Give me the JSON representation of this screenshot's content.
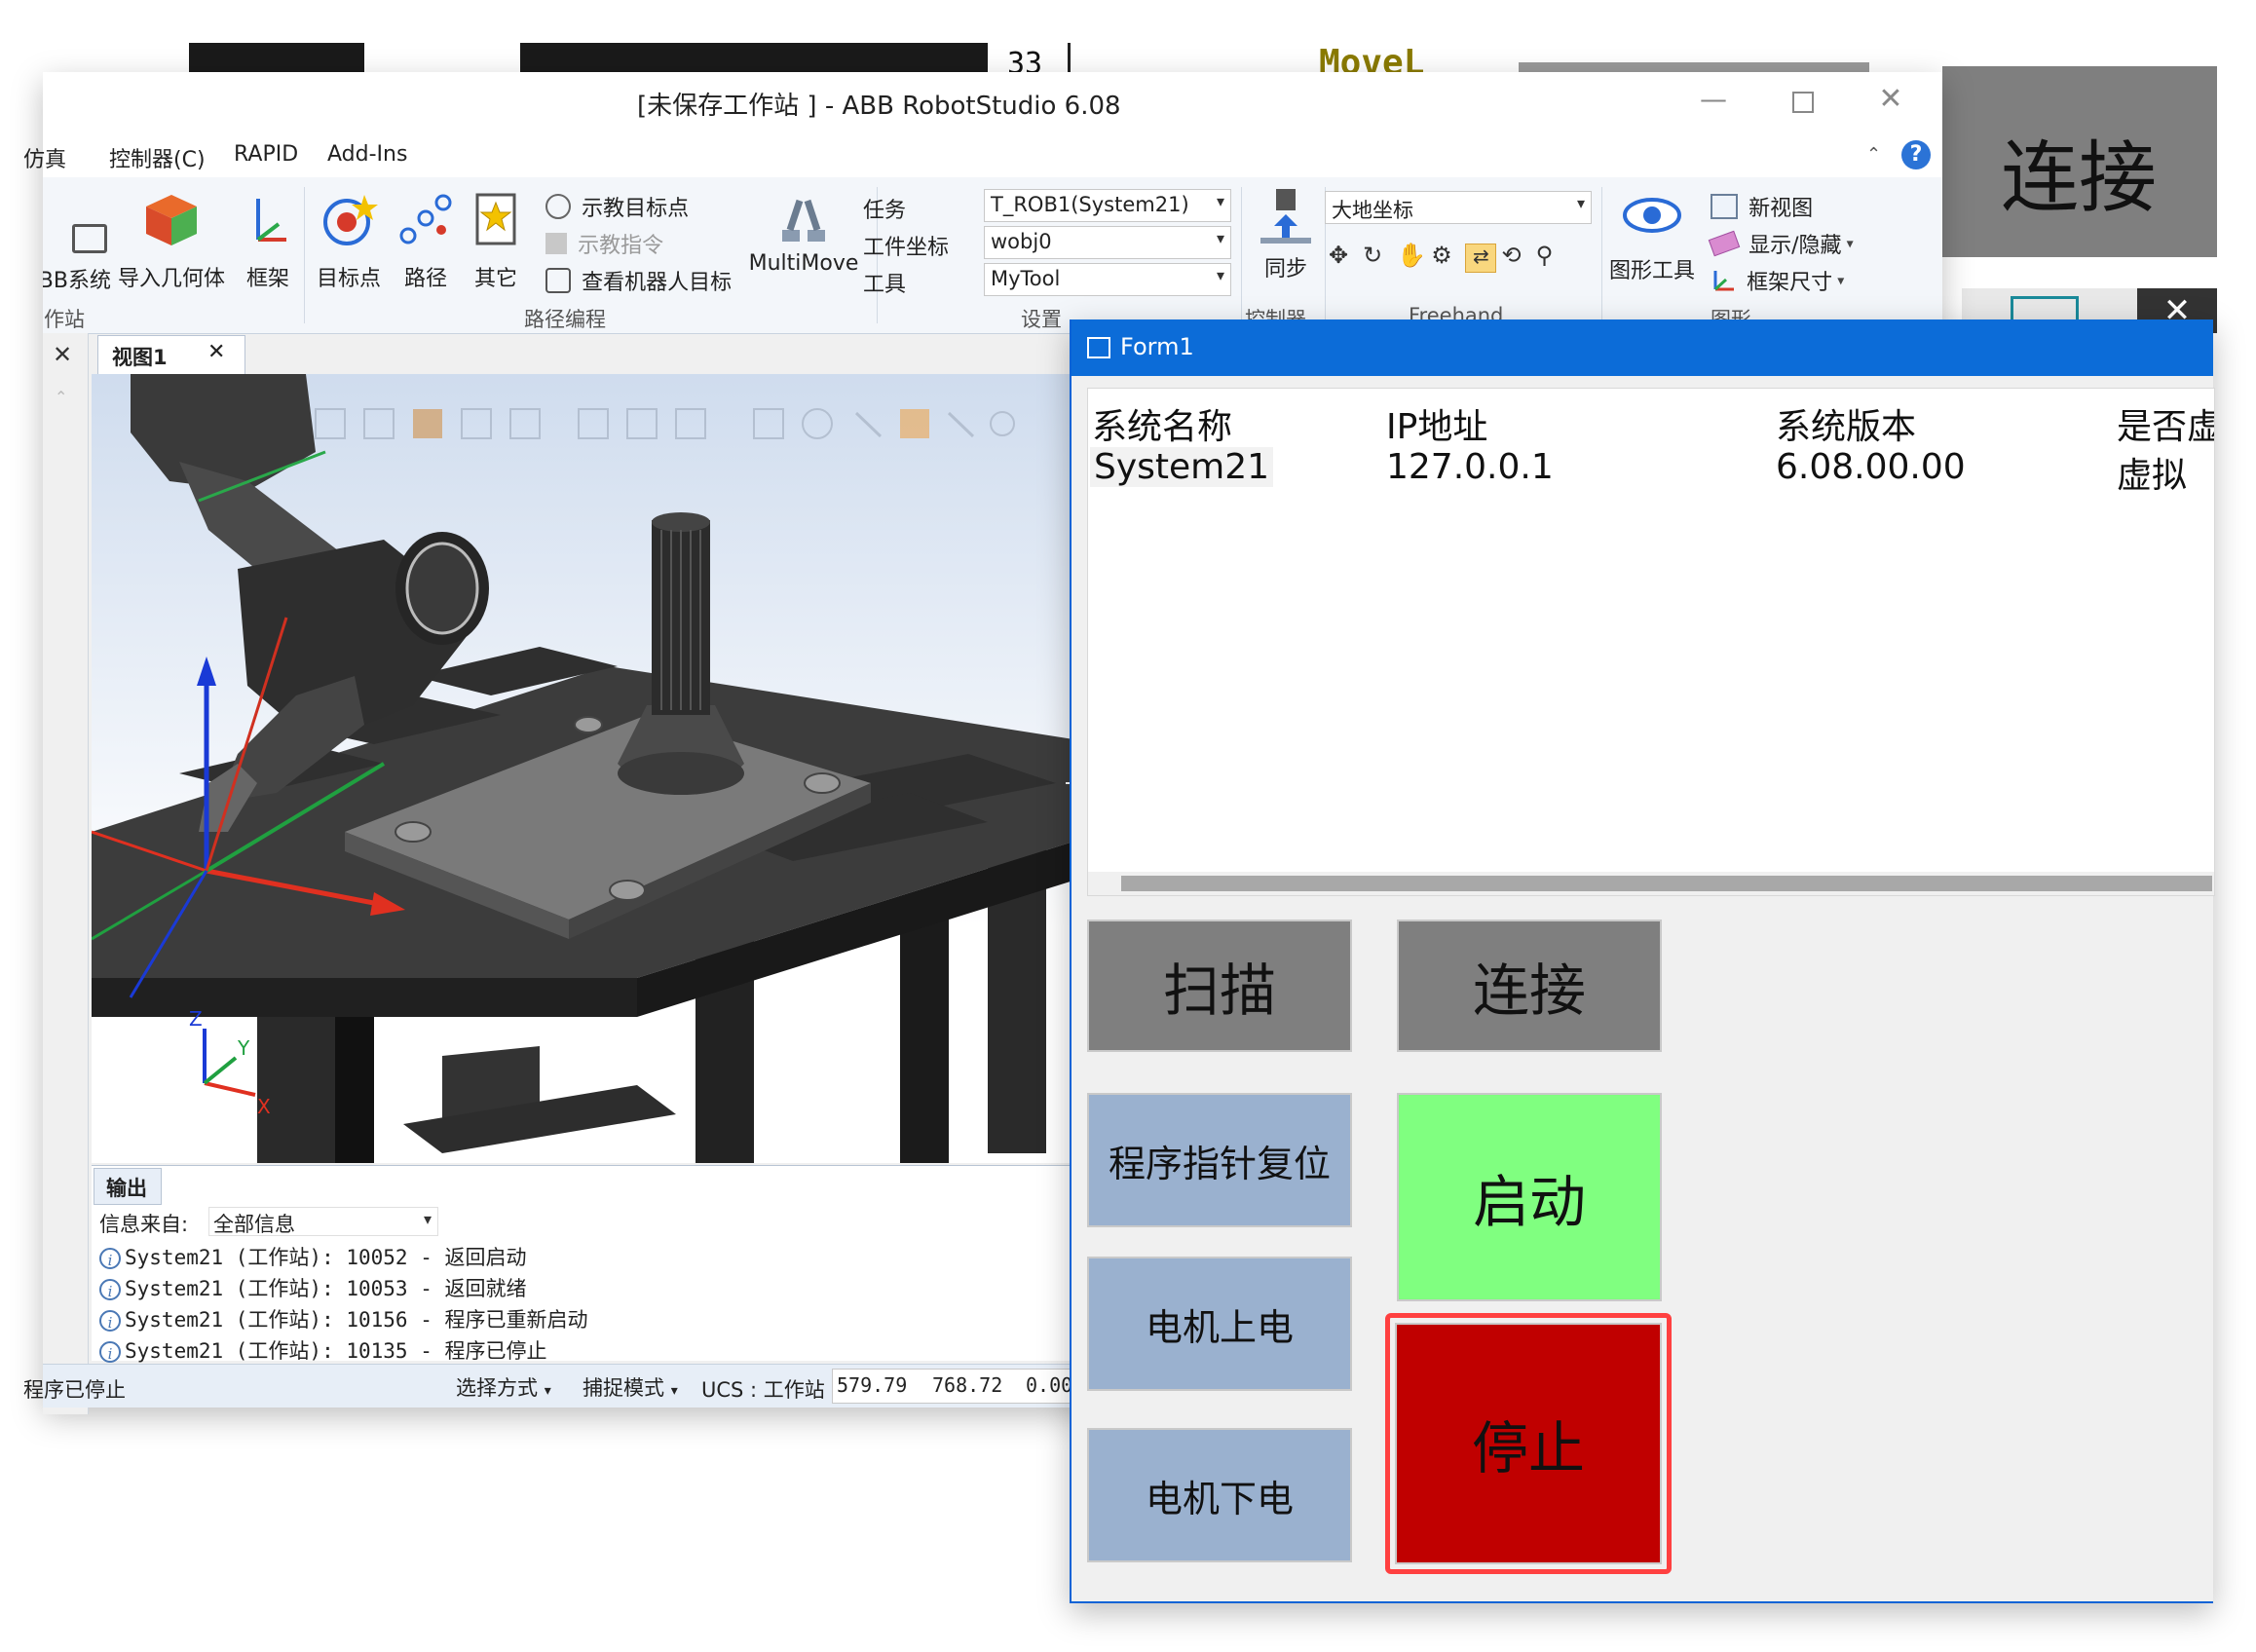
{
  "background_app": {
    "ruler_number": "33",
    "code_text": "MoveL",
    "connect_label": "连接"
  },
  "window": {
    "title": "[未保存工作站 ] - ABB RobotStudio 6.08"
  },
  "menu": {
    "items": [
      "仿真",
      "控制器(C)",
      "RAPID",
      "Add-Ins"
    ]
  },
  "ribbon": {
    "system_label": "ABB系统",
    "import_geometry": "导入几何体",
    "frame": "框架",
    "target": "目标点",
    "path": "路径",
    "other": "其它",
    "teach_target": "示教目标点",
    "teach_instruction": "示教指令",
    "view_robot_target": "查看机器人目标",
    "multimove": "MultiMove",
    "group_build": "工作站",
    "group_path": "路径编程",
    "task_label": "任务",
    "wobj_label": "工件坐标",
    "tool_label": "工具",
    "task_value": "T_ROB1(System21)",
    "wobj_value": "wobj0",
    "tool_value": "MyTool",
    "group_settings": "设置",
    "sync": "同步",
    "group_controller": "控制器",
    "coord_value": "大地坐标",
    "group_freehand": "Freehand",
    "graphics_tools": "图形工具",
    "new_view": "新视图",
    "show_hide": "显示/隐藏",
    "frame_size": "框架尺寸",
    "group_graphics": "图形"
  },
  "viewport": {
    "tab_label": "视图1",
    "axis_z": "Z",
    "axis_y": "Y",
    "axis_x": "X"
  },
  "output": {
    "tab_label": "输出",
    "filter_label": "信息来自:",
    "filter_value": "全部信息",
    "lines": [
      "System21 (工作站): 10052 - 返回启动",
      "System21 (工作站): 10053 - 返回就绪",
      "System21 (工作站): 10156 - 程序已重新启动",
      "System21 (工作站): 10135 - 程序已停止"
    ]
  },
  "statusbar": {
    "status_text": "程序已停止",
    "select_mode": "选择方式",
    "snap_mode": "捕捉模式",
    "ucs": "UCS : 工作站",
    "coord_x": "579.79",
    "coord_y": "768.72",
    "coord_z": "0.00"
  },
  "form1": {
    "title": "Form1",
    "headers": [
      "系统名称",
      "IP地址",
      "系统版本",
      "是否虚"
    ],
    "row": [
      "System21",
      "127.0.0.1",
      "6.08.00.00",
      "虚拟"
    ],
    "btn_scan": "扫描",
    "btn_connect": "连接",
    "btn_reset_pointer": "程序指针复位",
    "btn_start": "启动",
    "btn_motor_on": "电机上电",
    "btn_motor_off": "电机下电",
    "btn_stop": "停止",
    "colors": {
      "gray_button": "#7f7f7f",
      "blue_button": "#9ab1cf",
      "start_button": "#80ff80",
      "stop_button": "#c00000",
      "highlight": "#ff4040"
    }
  }
}
